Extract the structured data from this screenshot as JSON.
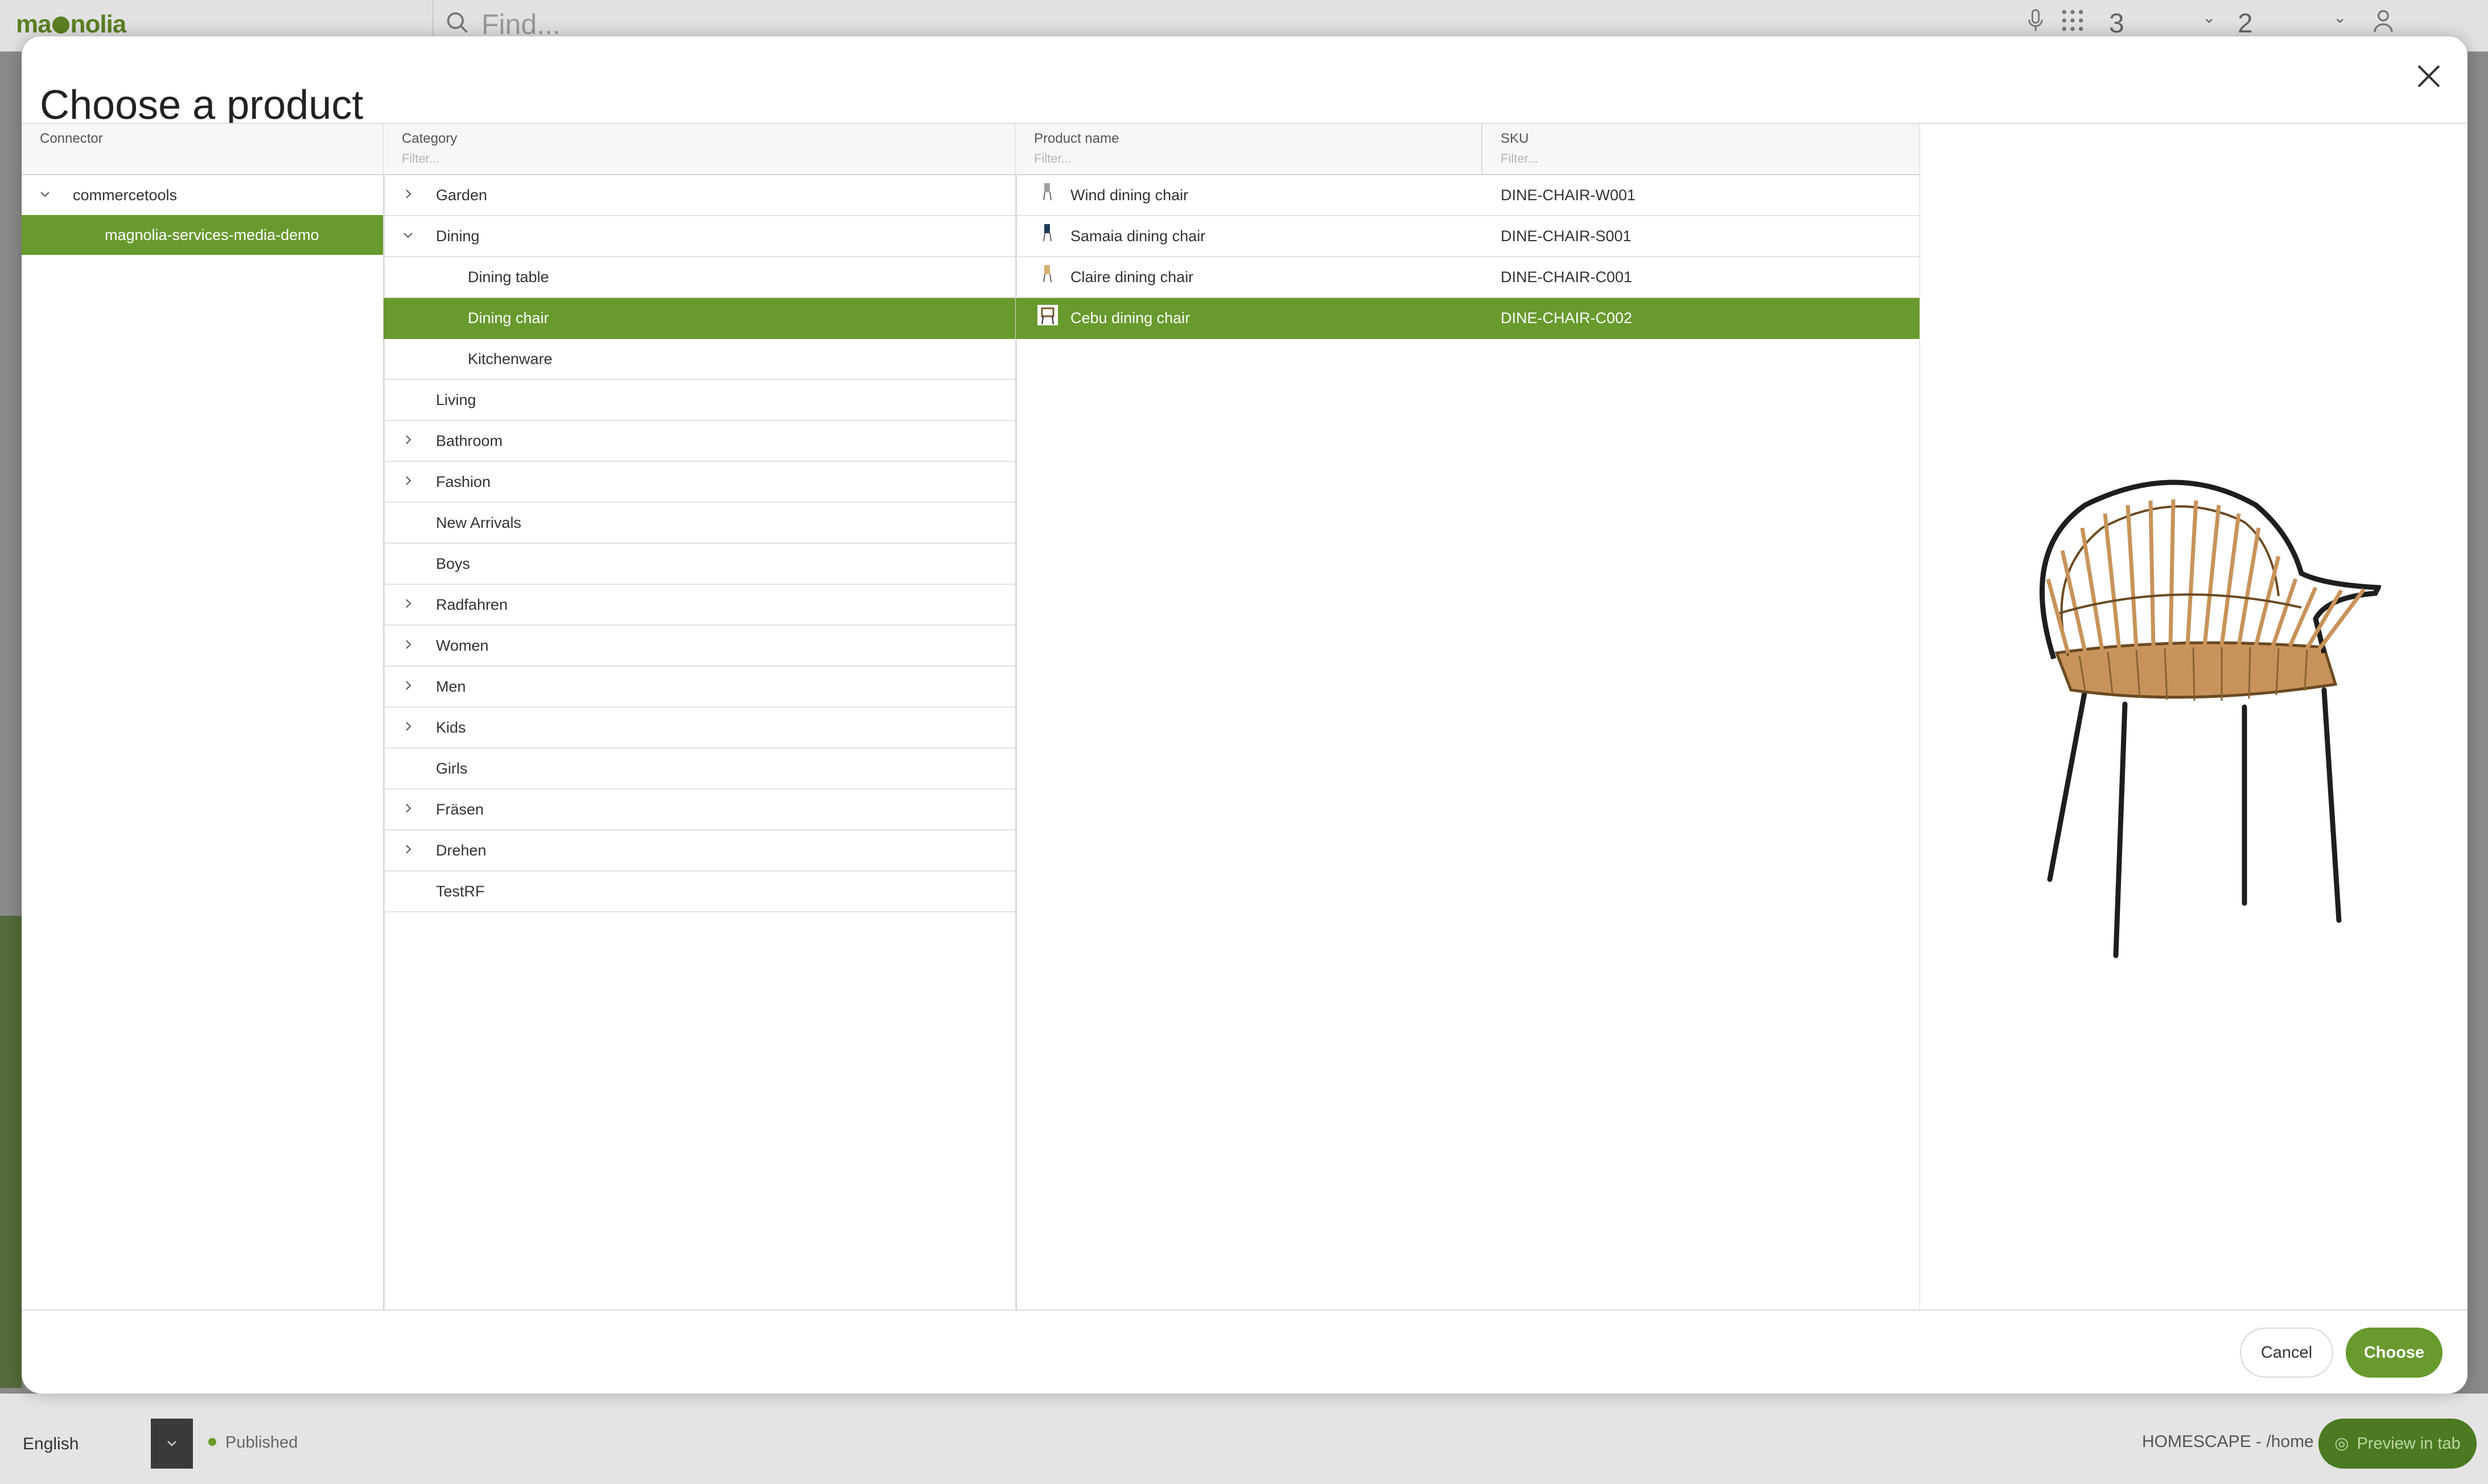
{
  "app": {
    "logo": "magnolia",
    "search_placeholder": "Find...",
    "notif_count_1": "3",
    "notif_count_2": "2",
    "language": "English",
    "status": "Published",
    "page_path": "HOMESCAPE - /home",
    "preview_label": "Preview in tab"
  },
  "dialog": {
    "title": "Choose a product",
    "cancel_label": "Cancel",
    "choose_label": "Choose"
  },
  "connector": {
    "header": "Connector",
    "items": [
      {
        "label": "commercetools",
        "expanded": true
      },
      {
        "label": "magnolia-services-media-demo",
        "selected": true
      }
    ]
  },
  "category": {
    "header": "Category",
    "filter_placeholder": "Filter...",
    "items": [
      {
        "label": "Garden",
        "chevron": "right"
      },
      {
        "label": "Dining",
        "chevron": "down"
      },
      {
        "label": "Dining table"
      },
      {
        "label": "Dining chair",
        "selected": true
      },
      {
        "label": "Kitchenware"
      },
      {
        "label": "Living"
      },
      {
        "label": "Bathroom",
        "chevron": "right"
      },
      {
        "label": "Fashion",
        "chevron": "right"
      },
      {
        "label": "New Arrivals"
      },
      {
        "label": "Boys"
      },
      {
        "label": "Radfahren",
        "chevron": "right"
      },
      {
        "label": "Women",
        "chevron": "right"
      },
      {
        "label": "Men",
        "chevron": "right"
      },
      {
        "label": "Kids",
        "chevron": "right"
      },
      {
        "label": "Girls"
      },
      {
        "label": "Fräsen",
        "chevron": "right"
      },
      {
        "label": "Drehen",
        "chevron": "right"
      },
      {
        "label": "TestRF"
      }
    ]
  },
  "products": {
    "name_header": "Product name",
    "sku_header": "SKU",
    "filter_placeholder": "Filter...",
    "items": [
      {
        "name": "Wind dining chair",
        "sku": "DINE-CHAIR-W001"
      },
      {
        "name": "Samaia dining chair",
        "sku": "DINE-CHAIR-S001"
      },
      {
        "name": "Claire dining chair",
        "sku": "DINE-CHAIR-C001"
      },
      {
        "name": "Cebu dining chair",
        "sku": "DINE-CHAIR-C002",
        "selected": true
      }
    ]
  },
  "colors": {
    "accent": "#689a2e",
    "brand": "#5b7f22"
  }
}
